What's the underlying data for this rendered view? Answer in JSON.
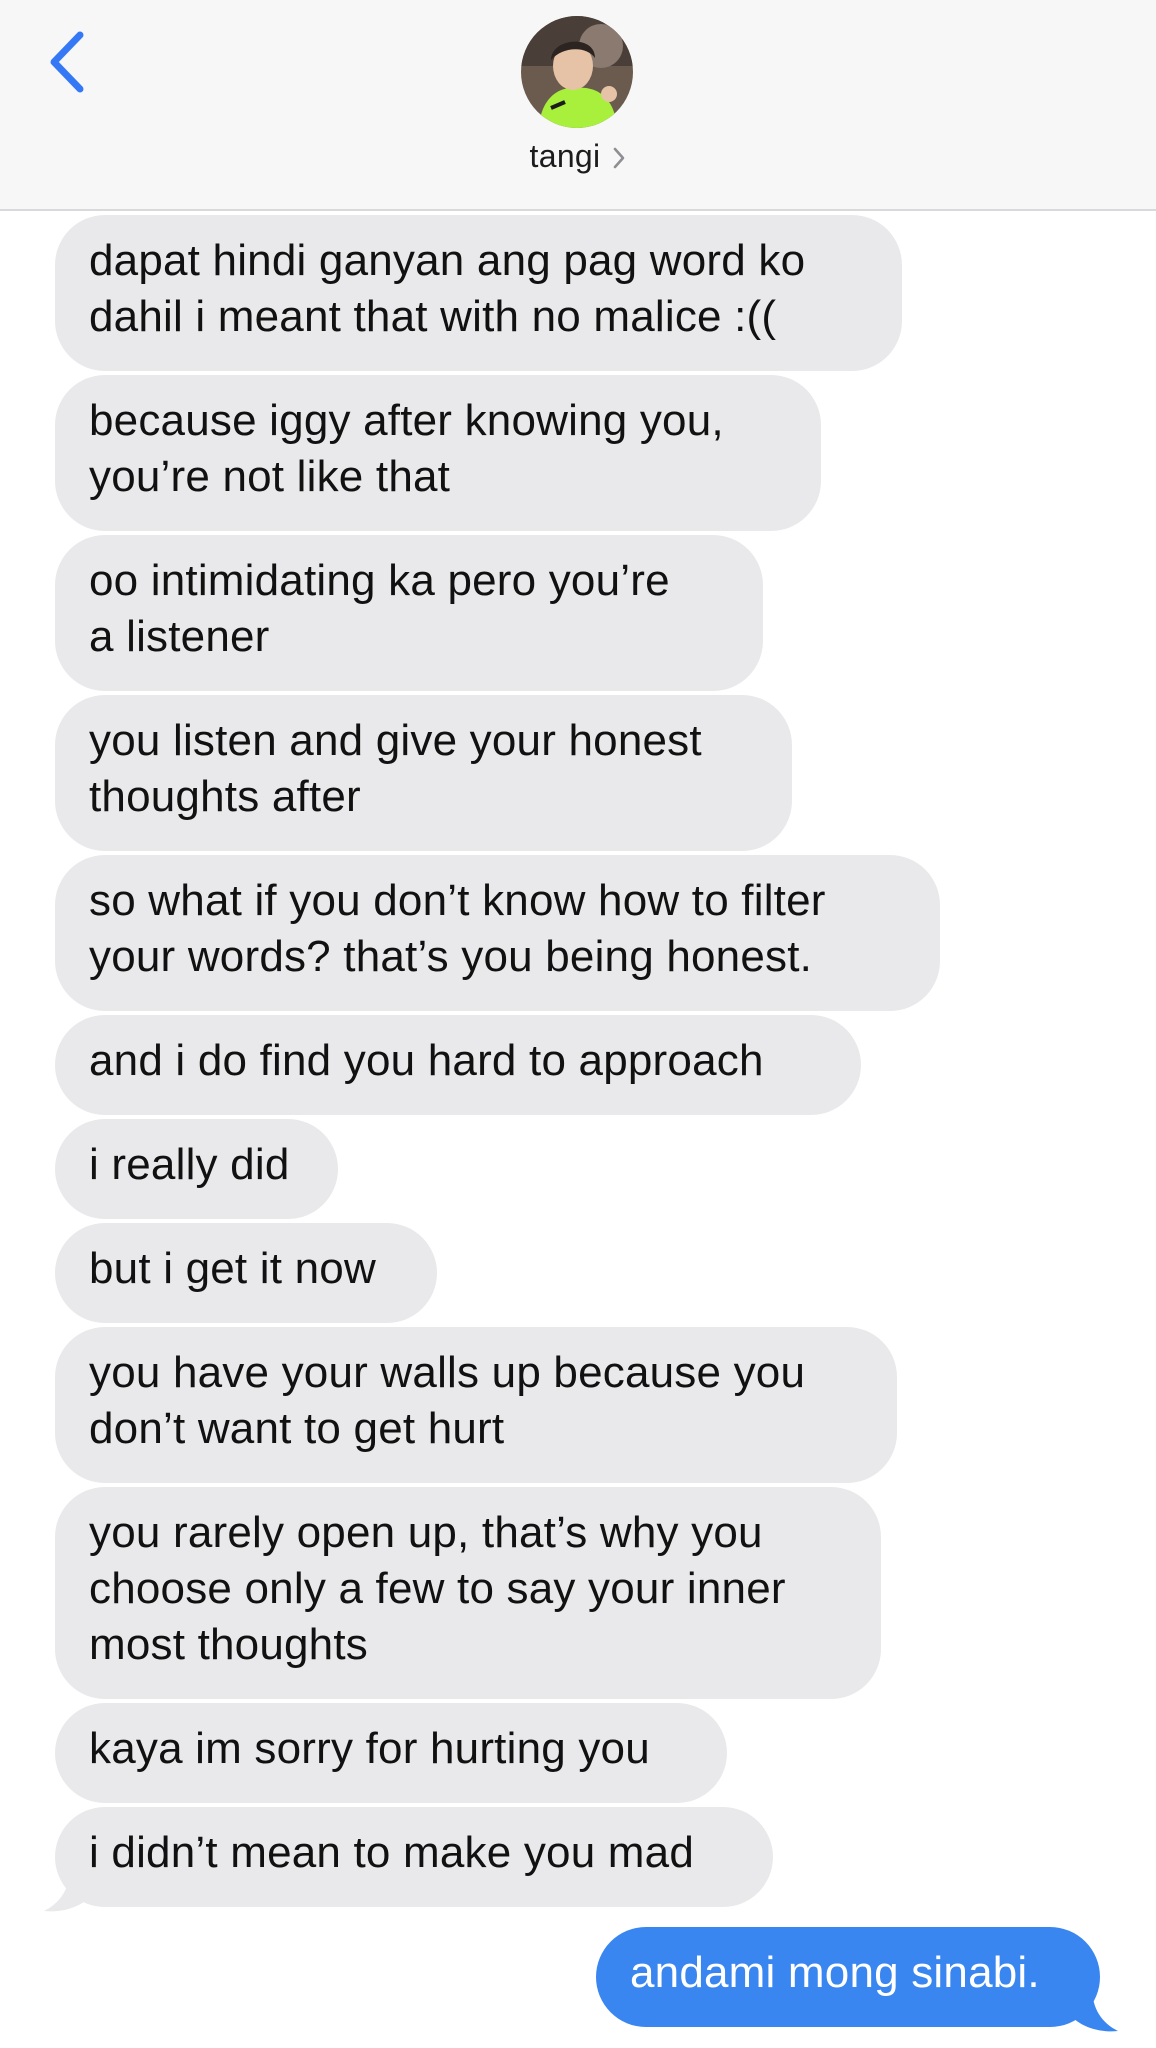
{
  "header": {
    "contact_name": "tangi",
    "avatar_colors": {
      "shirt": "#a8f03c",
      "background": "#6b5a4e",
      "skin": "#e6c3a6"
    }
  },
  "colors": {
    "accent": "#3478f6",
    "incoming_bubble": "#e9e9eb",
    "outgoing_bubble": "#3a86f0"
  },
  "messages": [
    {
      "direction": "incoming",
      "text": "dapat hindi ganyan ang pag word ko\ndahil i meant that with no malice :(("
    },
    {
      "direction": "incoming",
      "text": "because iggy after knowing you,\nyou’re not like that"
    },
    {
      "direction": "incoming",
      "text": "oo intimidating ka pero you’re\na listener"
    },
    {
      "direction": "incoming",
      "text": "you listen and give your honest\nthoughts after"
    },
    {
      "direction": "incoming",
      "text": "so what if you don’t know how to filter\nyour words? that’s you being honest."
    },
    {
      "direction": "incoming",
      "text": "and i do find you hard to approach"
    },
    {
      "direction": "incoming",
      "text": "i really did"
    },
    {
      "direction": "incoming",
      "text": "but i get it now"
    },
    {
      "direction": "incoming",
      "text": "you have your walls up because you\ndon’t want to get hurt"
    },
    {
      "direction": "incoming",
      "text": "you rarely open up, that’s why you\nchoose only a few to say your inner\nmost thoughts"
    },
    {
      "direction": "incoming",
      "text": "kaya im sorry for hurting you"
    },
    {
      "direction": "incoming",
      "text": "i didn’t mean to make you mad"
    },
    {
      "direction": "outgoing",
      "text": "andami mong sinabi."
    }
  ]
}
